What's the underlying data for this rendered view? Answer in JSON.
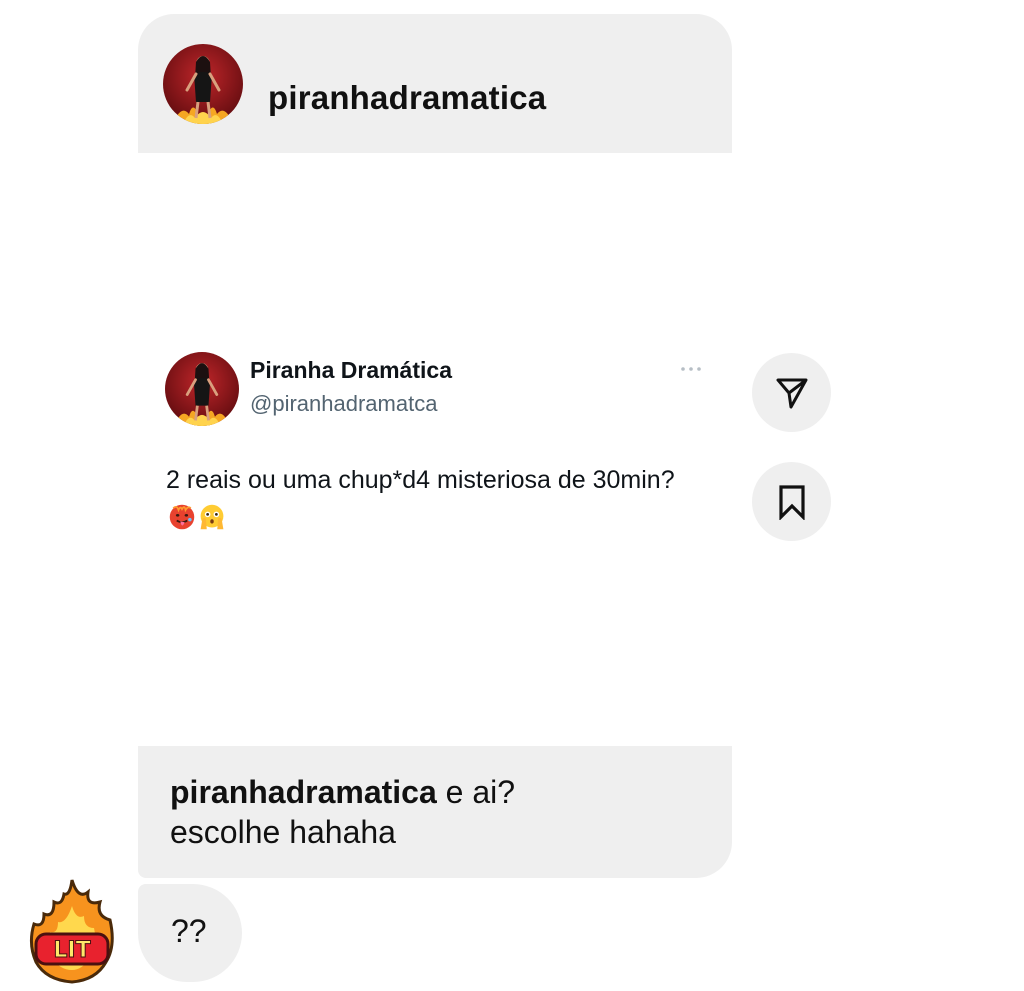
{
  "shared_post": {
    "username": "piranhadramatica"
  },
  "tweet": {
    "display_name": "Piranha Dramática",
    "handle": "@piranhadramatca",
    "text": "2 reais ou uma chup*d4 misteriosa de 30min?",
    "emojis": [
      "hot-face-emoji",
      "flushed-hands-face-emoji"
    ]
  },
  "actions": {
    "send_icon": "paper-plane-icon",
    "save_icon": "bookmark-icon"
  },
  "caption": {
    "user": "piranhadramatica",
    "text_line1": " e ai?",
    "text_line2": "escolhe hahaha"
  },
  "reply": {
    "text": "??",
    "sticker": "LIT"
  },
  "colors": {
    "bubble": "#efefef",
    "handle": "#536471",
    "flame_orange": "#f7931e",
    "flame_red": "#e8222e"
  }
}
